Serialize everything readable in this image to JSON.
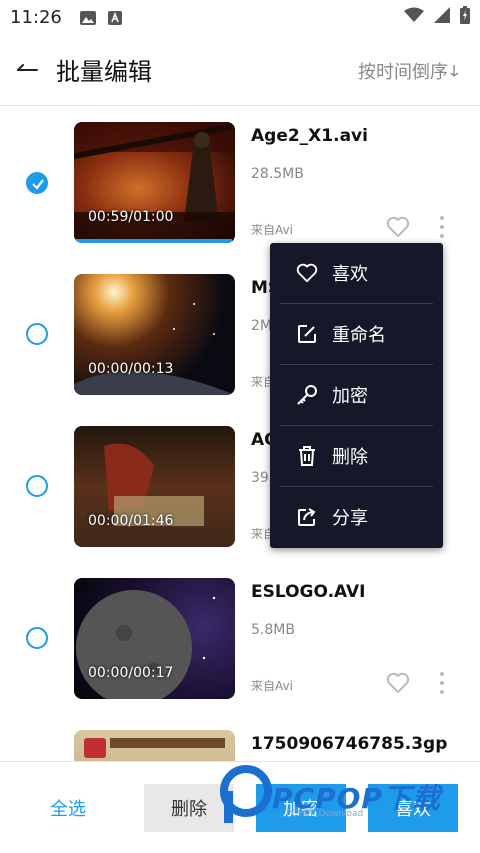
{
  "status_bar": {
    "time": "11:26"
  },
  "header": {
    "title": "批量编辑",
    "sort_label": "按时间倒序"
  },
  "items": [
    {
      "name": "Age2_X1.avi",
      "size": "28.5MB",
      "source": "来自Avi",
      "duration": "00:59/01:00",
      "checked": true,
      "progress": 0.98
    },
    {
      "name": "MS",
      "size": "2M",
      "source": "来自",
      "duration": "00:00/00:13",
      "checked": false
    },
    {
      "name": "AC",
      "size": "39",
      "source": "来自",
      "duration": "00:00/01:46",
      "checked": false
    },
    {
      "name": "ESLOGO.AVI",
      "size": "5.8MB",
      "source": "来自Avi",
      "duration": "00:00/00:17",
      "checked": false
    },
    {
      "name": "1750906746785.3gp",
      "checked": false
    }
  ],
  "menu": {
    "items": [
      {
        "label": "喜欢",
        "icon": "heart-icon"
      },
      {
        "label": "重命名",
        "icon": "edit-icon"
      },
      {
        "label": "加密",
        "icon": "key-icon"
      },
      {
        "label": "删除",
        "icon": "trash-icon"
      },
      {
        "label": "分享",
        "icon": "share-icon"
      }
    ]
  },
  "bottom_bar": {
    "select_all": "全选",
    "delete": "删除",
    "encrypt": "加密",
    "favorite": "喜欢"
  },
  "watermark": {
    "text": "PCPOP下载",
    "sub": "PCPOP Download"
  },
  "colors": {
    "accent": "#1e9be9",
    "menu_bg": "#151828"
  }
}
